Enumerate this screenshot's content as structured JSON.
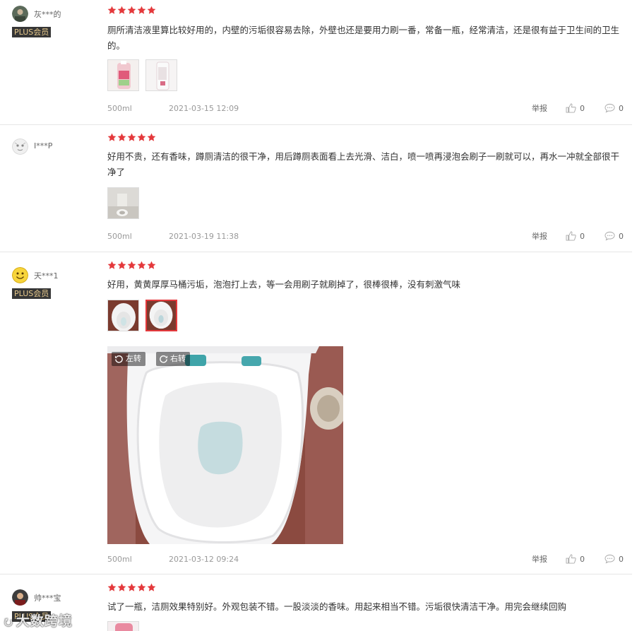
{
  "reviews": [
    {
      "username": "灰***的",
      "badge": "PLUS会员",
      "content": "厕所清洁液里算比较好用的，内壁的污垢很容易去除，外壁也还是要用力刷一番，常备一瓶，经常清洁，还是很有益于卫生间的卫生的。",
      "spec": "500ml",
      "date": "2021-03-15 12:09",
      "report": "举报",
      "likes": "0",
      "comments": "0"
    },
    {
      "username": "I***P",
      "content": "好用不贵，还有香味，蹲厕清洁的很干净，用后蹲厕表面看上去光滑、洁白，喷一喷再浸泡会刷子一刷就可以，再水一冲就全部很干净了",
      "spec": "500ml",
      "date": "2021-03-19 11:38",
      "report": "举报",
      "likes": "0",
      "comments": "0"
    },
    {
      "username": "天***1",
      "badge": "PLUS会员",
      "content": "好用，黄黄厚厚马桶污垢，泡泡打上去，等一会用刷子就刷掉了，很棒很棒，没有刺激气味",
      "rotate_left": "左转",
      "rotate_right": "右转",
      "spec": "500ml",
      "date": "2021-03-12 09:24",
      "report": "举报",
      "likes": "0",
      "comments": "0"
    },
    {
      "username": "帅***宝",
      "badge": "PLUS会员",
      "content": "试了一瓶，洁厕效果特别好。外观包装不错。一股淡淡的香味。用起来相当不错。污垢很快清洁干净。用完会继续回购"
    }
  ],
  "rating_stars": 5,
  "watermark": "大数跨境",
  "colors": {
    "star": "#e4393c",
    "plus_bg": "#363636",
    "plus_text": "#e6c88b",
    "meta_text": "#999999"
  },
  "icons": {
    "like": "thumbs-up-icon",
    "comment": "speech-bubble-icon",
    "rotate": "rotate-icon"
  }
}
